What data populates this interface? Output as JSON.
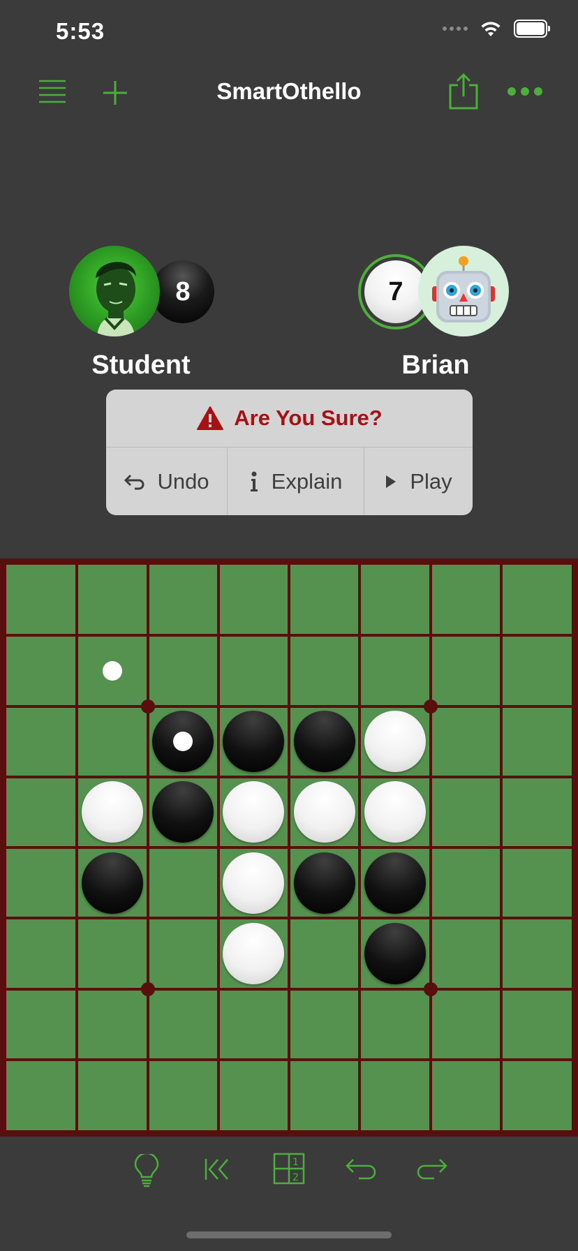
{
  "status_bar": {
    "time": "5:53"
  },
  "nav": {
    "title": "SmartOthello",
    "left_icons": [
      "menu-icon",
      "plus-icon"
    ],
    "right_icons": [
      "share-icon",
      "more-icon"
    ]
  },
  "accent_color": "#4cae3b",
  "players": {
    "left": {
      "name": "Student",
      "score": "8",
      "color": "black",
      "avatar": "student-avatar"
    },
    "right": {
      "name": "Brian",
      "score": "7",
      "color": "white",
      "avatar": "robot-avatar"
    }
  },
  "alert": {
    "title": "Are You Sure?",
    "icon": "warning-icon",
    "title_color": "#a51115",
    "actions": [
      {
        "label": "Undo",
        "icon": "undo-arrow-icon"
      },
      {
        "label": "Explain",
        "icon": "info-icon"
      },
      {
        "label": "Play",
        "icon": "play-icon"
      }
    ]
  },
  "board": {
    "size": 8,
    "rows": [
      "........",
      "........",
      "..BBBW..",
      ".WBWWW..",
      ".B.WBB..",
      "...W.B..",
      "........",
      "........"
    ],
    "last_move": [
      2,
      2
    ],
    "hint_markers": [
      [
        1,
        1
      ]
    ],
    "line_color": "#5a0f0f",
    "cell_color": "#55914f"
  },
  "toolbar": {
    "icons": [
      "lightbulb-icon",
      "rewind-to-start-icon",
      "numbered-board-icon",
      "undo-icon",
      "redo-icon"
    ]
  }
}
